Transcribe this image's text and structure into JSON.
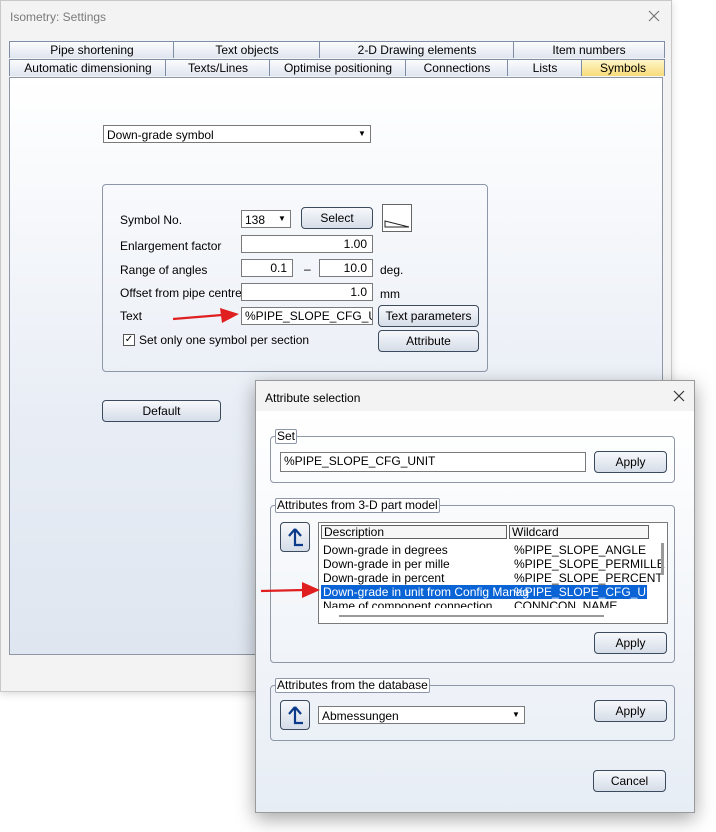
{
  "window": {
    "title": "Isometry: Settings"
  },
  "tabs_row1": [
    "Pipe shortening",
    "Text objects",
    "2-D Drawing elements",
    "Item numbers"
  ],
  "tabs_row2": [
    "Automatic dimensioning",
    "Texts/Lines",
    "Optimise positioning",
    "Connections",
    "Lists",
    "Symbols"
  ],
  "symbol_select": "Down-grade symbol",
  "form": {
    "symbol_no_label": "Symbol No.",
    "symbol_no_value": "138",
    "select_button": "Select",
    "enlargement_label": "Enlargement factor",
    "enlargement_value": "1.00",
    "range_label": "Range of angles",
    "range_min": "0.1",
    "range_dash": "–",
    "range_max": "10.0",
    "range_unit": "deg.",
    "offset_label": "Offset from pipe centre",
    "offset_value": "1.0",
    "offset_unit": "mm",
    "text_label": "Text",
    "text_value": "%PIPE_SLOPE_CFG_UNIT",
    "text_params_button": "Text parameters",
    "attribute_button": "Attribute",
    "one_symbol_label": "Set only one symbol per section",
    "one_symbol_checked": true
  },
  "default_button": "Default",
  "dialog": {
    "title": "Attribute selection",
    "set_label": "Set",
    "set_value": "%PIPE_SLOPE_CFG_UNIT",
    "apply": "Apply",
    "attrs3d_label": "Attributes from 3-D part model",
    "columns": [
      "Description",
      "Wildcard"
    ],
    "rows": [
      {
        "desc": "Down-grade in degrees",
        "wild": "%PIPE_SLOPE_ANGLE",
        "selected": false
      },
      {
        "desc": "Down-grade in per mille",
        "wild": "%PIPE_SLOPE_PERMILLE",
        "selected": false
      },
      {
        "desc": "Down-grade in percent",
        "wild": "%PIPE_SLOPE_PERCENT",
        "selected": false
      },
      {
        "desc": "Down-grade in unit from Config Manag",
        "wild": "%PIPE_SLOPE_CFG_UNIT",
        "selected": true
      },
      {
        "desc": "Name of component connection",
        "wild": "CONNCON_NAME",
        "selected": false
      }
    ],
    "db_label": "Attributes from the database",
    "db_value": "Abmessungen",
    "cancel": "Cancel"
  },
  "colors": {
    "annotation_arrow": "#e02020",
    "selection": "#0a64d6",
    "active_tab": "#f7dc7a"
  }
}
